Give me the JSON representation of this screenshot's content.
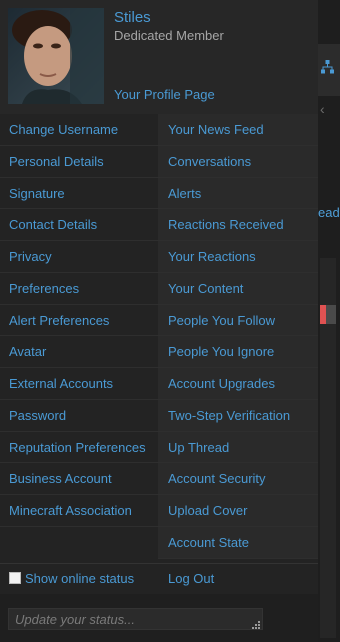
{
  "profile": {
    "username": "Stiles",
    "user_title": "Dedicated Member",
    "profile_link": "Your Profile Page",
    "avatar_alt": "user avatar"
  },
  "menu_left": [
    "Change Username",
    "Personal Details",
    "Signature",
    "Contact Details",
    "Privacy",
    "Preferences",
    "Alert Preferences",
    "Avatar",
    "External Accounts",
    "Password",
    "Reputation Preferences",
    "Business Account",
    "Minecraft Association"
  ],
  "menu_right": [
    "Your News Feed",
    "Conversations",
    "Alerts",
    "Reactions Received",
    "Your Reactions",
    "Your Content",
    "People You Follow",
    "People You Ignore",
    "Account Upgrades",
    "Two-Step Verification",
    "Up Thread",
    "Account Security",
    "Upload Cover",
    "Account State"
  ],
  "footer": {
    "show_online_status": "Show online status",
    "logout": "Log Out"
  },
  "status": {
    "placeholder": "Update your status..."
  },
  "background_page": {
    "edge_text": "ead",
    "icons": [
      "sitemap-icon",
      "chevron-left-icon"
    ]
  },
  "colors": {
    "link": "#4a9ad4",
    "menu_bg": "#232323",
    "header_bg": "#272727",
    "secondary_text": "#a6a6a6"
  }
}
